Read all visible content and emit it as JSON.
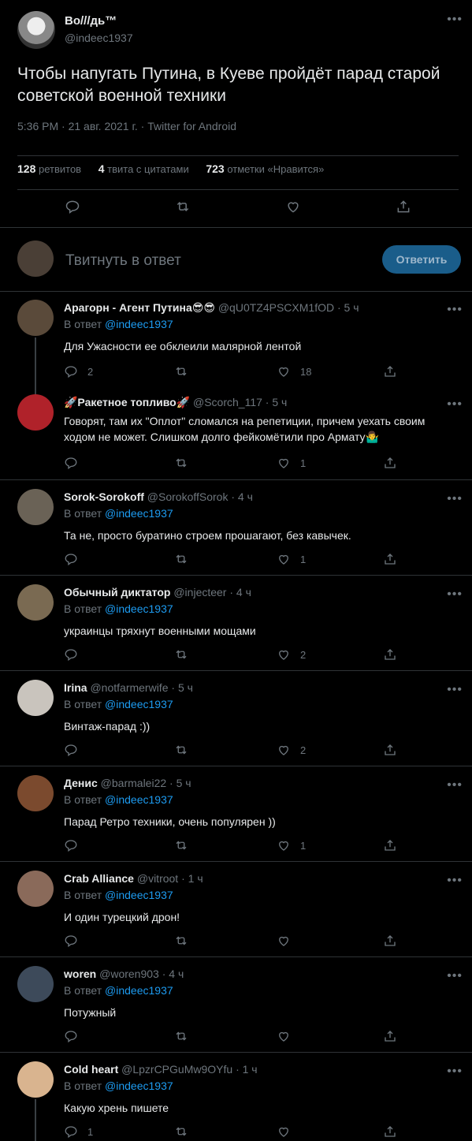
{
  "main": {
    "name": "Во///дь™",
    "handle": "@indeec1937",
    "text": "Чтобы напугать Путина, в Куеве пройдёт парад старой советской военной техники",
    "meta": "5:36 PM · 21 авг. 2021 г. · Twitter for Android",
    "retweets_count": "128",
    "retweets_label": "ретвитов",
    "quotes_count": "4",
    "quotes_label": "твита с цитатами",
    "likes_count": "723",
    "likes_label": "отметки «Нравится»"
  },
  "reply_box": {
    "placeholder": "Твитнуть в ответ",
    "button": "Ответить"
  },
  "icons": {
    "more": "more-icon",
    "reply": "reply-icon",
    "retweet": "retweet-icon",
    "like": "like-icon",
    "share": "share-icon"
  },
  "replies": [
    {
      "name": "Арагорн - Агент Путина😎😎",
      "handle": "@qU0TZ4PSCXM1fOD",
      "time": "· 5 ч",
      "to_prefix": "В ответ",
      "to": "@indeec1937",
      "text": "Для Ужасности ее обклеили малярной лентой",
      "replies": "2",
      "retweets": "",
      "likes": "18",
      "avatar_color": "#5a4a3a"
    },
    {
      "name": "🚀Ракетное топливо🚀",
      "handle": "@Scorch_117",
      "time": "· 5 ч",
      "to_prefix": "",
      "to": "",
      "text": "Говорят, там их \"Оплот\" сломался на репетиции, причем уехать своим ходом не может. Слишком долго фейкомётили про Армату🤷‍♂️",
      "replies": "",
      "retweets": "",
      "likes": "1",
      "avatar_color": "#b0222a"
    },
    {
      "name": "Sorok-Sorokoff",
      "handle": "@SorokoffSorok",
      "time": "· 4 ч",
      "to_prefix": "В ответ",
      "to": "@indeec1937",
      "text": "Та не, просто буратино строем прошагают, без кавычек.",
      "replies": "",
      "retweets": "",
      "likes": "1",
      "avatar_color": "#6a6256"
    },
    {
      "name": "Обычный диктатор",
      "handle": "@injecteer",
      "time": "· 4 ч",
      "to_prefix": "В ответ",
      "to": "@indeec1937",
      "text": "украинцы тряхнут военными мощами",
      "replies": "",
      "retweets": "",
      "likes": "2",
      "avatar_color": "#7a6a52"
    },
    {
      "name": "Irina",
      "handle": "@notfarmerwife",
      "time": "· 5 ч",
      "to_prefix": "В ответ",
      "to": "@indeec1937",
      "text": "Винтаж-парад :))",
      "replies": "",
      "retweets": "",
      "likes": "2",
      "avatar_color": "#c9c4bd"
    },
    {
      "name": "Денис",
      "handle": "@barmalei22",
      "time": "· 5 ч",
      "to_prefix": "В ответ",
      "to": "@indeec1937",
      "text": "Парад Ретро техники, очень популярен ))",
      "replies": "",
      "retweets": "",
      "likes": "1",
      "avatar_color": "#7b4a2e"
    },
    {
      "name": "Crab Alliance",
      "handle": "@vitroot",
      "time": "· 1 ч",
      "to_prefix": "В ответ",
      "to": "@indeec1937",
      "text": "И один турецкий дрон!",
      "replies": "",
      "retweets": "",
      "likes": "",
      "avatar_color": "#8a6a5a"
    },
    {
      "name": "woren",
      "handle": "@woren903",
      "time": "· 4 ч",
      "to_prefix": "В ответ",
      "to": "@indeec1937",
      "text": "Потужный",
      "replies": "",
      "retweets": "",
      "likes": "",
      "avatar_color": "#3d4a5a"
    },
    {
      "name": "Cold heart",
      "handle": "@LpzrCPGuMw9OYfu",
      "time": "· 1 ч",
      "to_prefix": "В ответ",
      "to": "@indeec1937",
      "text": "Какую хрень пишете",
      "replies": "1",
      "retweets": "",
      "likes": "",
      "avatar_color": "#d9b48f"
    }
  ]
}
